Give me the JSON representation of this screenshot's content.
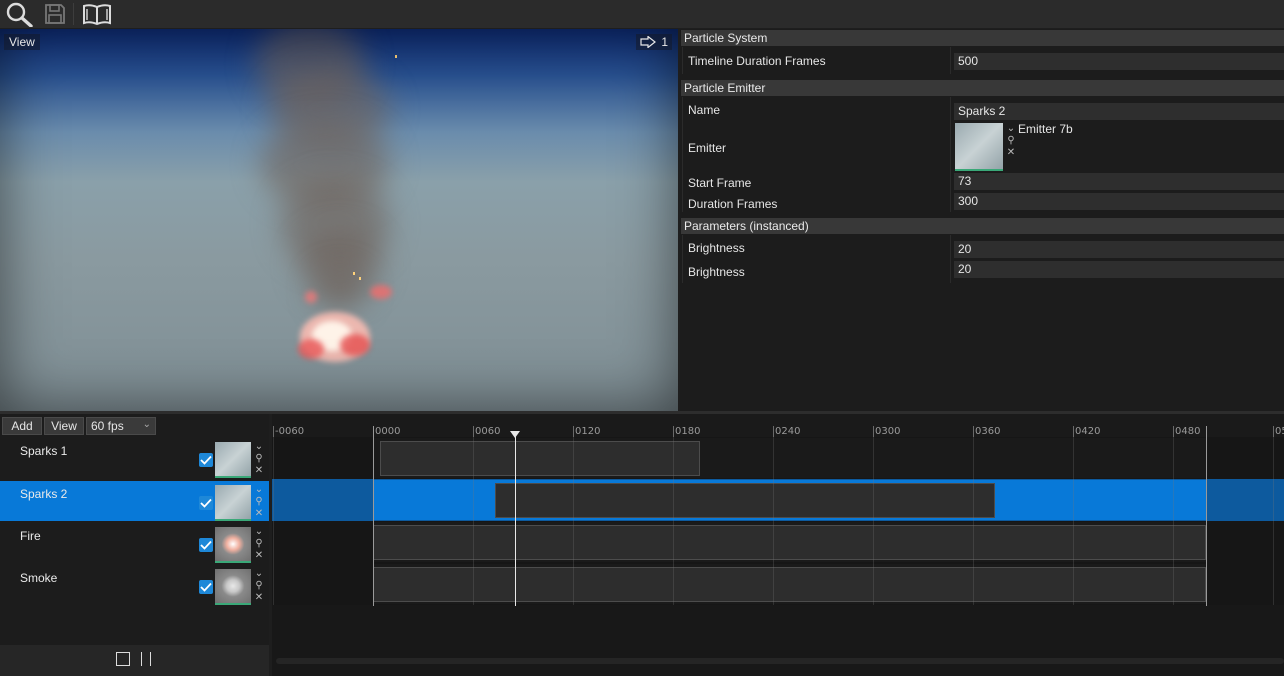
{
  "toolbar": {
    "icons": [
      "search-icon",
      "save-icon",
      "book-icon"
    ]
  },
  "viewport": {
    "view_label": "View",
    "count": "1"
  },
  "properties": {
    "particle_system": {
      "header": "Particle System",
      "timeline_duration_frames": {
        "label": "Timeline Duration Frames",
        "value": "500"
      }
    },
    "particle_emitter": {
      "header": "Particle Emitter",
      "name": {
        "label": "Name",
        "value": "Sparks 2"
      },
      "emitter": {
        "label": "Emitter",
        "value": "Emitter 7b"
      },
      "start_frame": {
        "label": "Start Frame",
        "value": "73"
      },
      "duration_frames": {
        "label": "Duration Frames",
        "value": "300"
      }
    },
    "parameters": {
      "header": "Parameters (instanced)",
      "items": [
        {
          "label": "Brightness",
          "value": "20"
        },
        {
          "label": "Brightness",
          "value": "20"
        }
      ]
    }
  },
  "emitter_list": {
    "add_label": "Add",
    "view_label": "View",
    "fps": "60 fps",
    "rows": [
      {
        "name": "Sparks 1",
        "checked": true,
        "selected": false
      },
      {
        "name": "Sparks 2",
        "checked": true,
        "selected": true
      },
      {
        "name": "Fire",
        "checked": true,
        "selected": false
      },
      {
        "name": "Smoke",
        "checked": true,
        "selected": false
      }
    ]
  },
  "timeline": {
    "ticks": [
      "-0060",
      "0000",
      "0060",
      "0120",
      "0180",
      "0240",
      "0300",
      "0360",
      "0420",
      "0480",
      "05"
    ],
    "playhead_frame": 85,
    "duration_frames": 500,
    "clips": [
      {
        "start": 4,
        "end": 196
      },
      {
        "start": 73,
        "end": 373
      },
      {
        "start": 0,
        "end": 500
      },
      {
        "start": 0,
        "end": 500
      }
    ]
  },
  "colors": {
    "accent": "#0879d8",
    "panel": "#1c1c1c",
    "section_header": "#383838"
  }
}
